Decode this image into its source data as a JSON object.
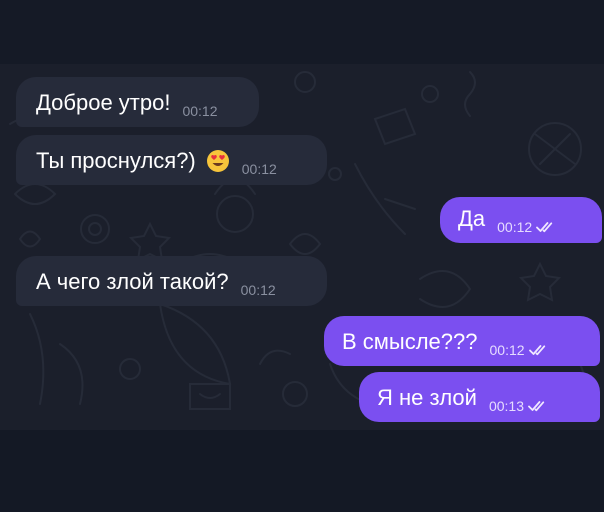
{
  "colors": {
    "background": "#151a26",
    "chat_background": "#1b1f2b",
    "incoming_bubble": "#262b3a",
    "outgoing_bubble": "#7b4ff0"
  },
  "messages": [
    {
      "direction": "incoming",
      "text": "Доброе утро!",
      "time": "00:12"
    },
    {
      "direction": "incoming",
      "text": "Ты проснулся?)",
      "emoji": "heart-eyes-emoji",
      "time": "00:12"
    },
    {
      "direction": "outgoing",
      "text": "Да",
      "time": "00:12",
      "status": "read"
    },
    {
      "direction": "incoming",
      "text": "А чего злой такой?",
      "time": "00:12"
    },
    {
      "direction": "outgoing",
      "text": "В смысле???",
      "time": "00:12",
      "status": "read"
    },
    {
      "direction": "outgoing",
      "text": "Я не злой",
      "time": "00:13",
      "status": "read"
    }
  ]
}
